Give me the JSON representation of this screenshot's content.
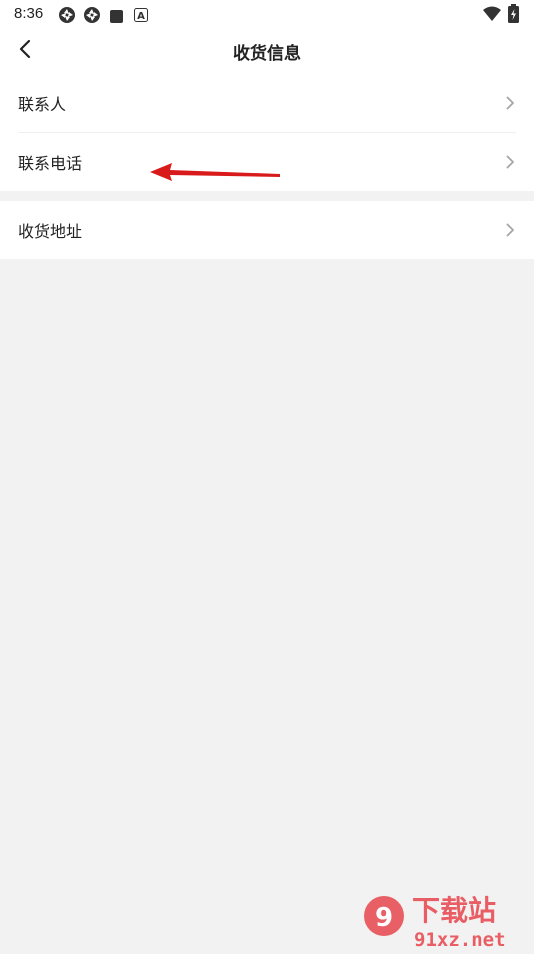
{
  "status_bar": {
    "time": "8:36",
    "icons": [
      "app-icon-1",
      "app-icon-2",
      "square-icon",
      "font-a-icon",
      "wifi-icon",
      "battery-charging-icon"
    ],
    "font_icon_letter": "A"
  },
  "header": {
    "title": "收货信息",
    "back_icon": "chevron-left-icon"
  },
  "groups": [
    {
      "items": [
        {
          "label": "联系人"
        },
        {
          "label": "联系电话"
        }
      ]
    },
    {
      "items": [
        {
          "label": "收货地址"
        }
      ]
    }
  ],
  "colors": {
    "background": "#f2f2f2",
    "card": "#ffffff",
    "text": "#222222",
    "chevron": "#a6a6a6",
    "annotation_arrow": "#d91a1a"
  },
  "watermark": {
    "text": "下载站",
    "domain": "91xz.net"
  }
}
